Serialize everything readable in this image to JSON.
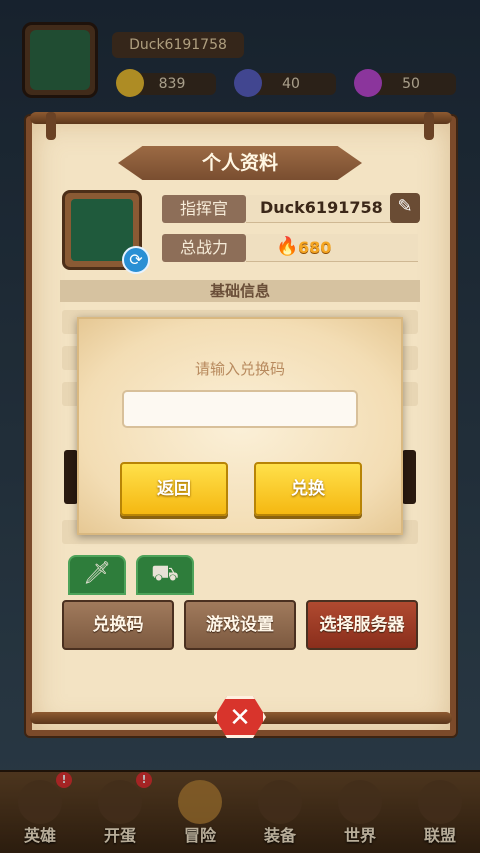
{
  "player": {
    "name": "Duck6191758",
    "power": "680"
  },
  "resources": [
    {
      "name": "gold",
      "value": "839",
      "color": "#f2c232"
    },
    {
      "name": "crystal",
      "value": "40",
      "color": "#5a62c8"
    },
    {
      "name": "gem",
      "value": "50",
      "color": "#c14ad8"
    }
  ],
  "profile": {
    "title": "个人资料",
    "commander_label": "指挥官",
    "commander_value": "Duck6191758",
    "power_label": "总战力",
    "power_value": "680",
    "section_basic": "基础信息"
  },
  "actions": {
    "redeem_code": "兑换码",
    "game_settings": "游戏设置",
    "select_server": "选择服务器"
  },
  "dialog": {
    "title": "请输入兑换码",
    "input_value": "",
    "back_label": "返回",
    "redeem_label": "兑换"
  },
  "bottom_nav": [
    {
      "label": "英雄",
      "badge": "!"
    },
    {
      "label": "开蛋",
      "badge": "!"
    },
    {
      "label": "冒险",
      "badge": ""
    },
    {
      "label": "装备",
      "badge": ""
    },
    {
      "label": "世界",
      "badge": ""
    },
    {
      "label": "联盟",
      "badge": ""
    }
  ],
  "colors": {
    "accent_yellow": "#f5c21b",
    "parchment": "#f3e3c3",
    "frame_brown": "#7b4a2a",
    "close_red": "#d8342c"
  }
}
